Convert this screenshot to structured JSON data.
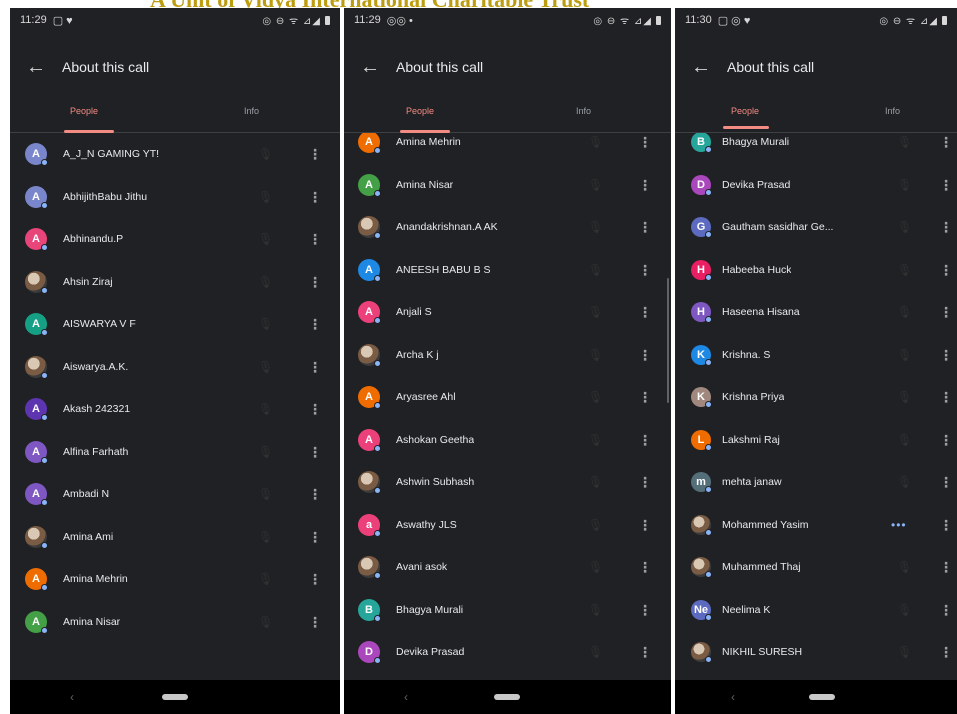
{
  "document_title": "A Unit of Vidya International Charitable Trust",
  "phones": [
    {
      "status_time": "11:29",
      "status_left_icons": "▢ ♥",
      "status_right_icons": "◎ ⊖ ᯤ ⊿◢",
      "app_title": "About this call",
      "tabs": [
        "People",
        "Info"
      ],
      "participants": [
        {
          "name": "A_J_N GAMING YT!",
          "initial": "A",
          "color": "#7986cb"
        },
        {
          "name": "AbhijithBabu Jithu",
          "initial": "A",
          "color": "#7986cb"
        },
        {
          "name": "Abhinandu.P",
          "initial": "A",
          "color": "#e8457a"
        },
        {
          "name": "Ahsin Ziraj",
          "initial": "",
          "color": "#c2185b",
          "photo": true
        },
        {
          "name": "AISWARYA V F",
          "initial": "A",
          "color": "#15a085"
        },
        {
          "name": "Aiswarya.A.K.",
          "initial": "",
          "color": "#f5a623",
          "photo": true
        },
        {
          "name": "Akash 242321",
          "initial": "A",
          "color": "#5e35b1"
        },
        {
          "name": "Alfina Farhath",
          "initial": "A",
          "color": "#7e57c2"
        },
        {
          "name": "Ambadi N",
          "initial": "A",
          "color": "#7e57c2"
        },
        {
          "name": "Amina Ami",
          "initial": "",
          "color": "#444444",
          "photo": true
        },
        {
          "name": "Amina Mehrin",
          "initial": "A",
          "color": "#ef6c00"
        },
        {
          "name": "Amina Nisar",
          "initial": "A",
          "color": "#43a047"
        }
      ]
    },
    {
      "status_time": "11:29",
      "status_left_icons": "◎◎ •",
      "status_right_icons": "◎ ⊖ ᯤ ⊿◢",
      "app_title": "About this call",
      "tabs": [
        "People",
        "Info"
      ],
      "participants": [
        {
          "name": "Amina Mehrin",
          "initial": "A",
          "color": "#ef6c00"
        },
        {
          "name": "Amina Nisar",
          "initial": "A",
          "color": "#43a047"
        },
        {
          "name": "Anandakrishnan.A AK",
          "initial": "",
          "color": "#555555",
          "photo": true
        },
        {
          "name": "ANEESH BABU B S",
          "initial": "A",
          "color": "#1e88e5"
        },
        {
          "name": "Anjali S",
          "initial": "A",
          "color": "#ec407a"
        },
        {
          "name": "Archa K j",
          "initial": "",
          "color": "#777777",
          "photo": true
        },
        {
          "name": "Aryasree Ahl",
          "initial": "A",
          "color": "#ef6c00"
        },
        {
          "name": "Ashokan Geetha",
          "initial": "A",
          "color": "#ec407a"
        },
        {
          "name": "Ashwin Subhash",
          "initial": "",
          "color": "#888888",
          "photo": true
        },
        {
          "name": "Aswathy JLS",
          "initial": "a",
          "color": "#ec407a"
        },
        {
          "name": "Avani asok",
          "initial": "",
          "color": "#4a6fa5",
          "photo": true
        },
        {
          "name": "Bhagya Murali",
          "initial": "B",
          "color": "#26a69a"
        },
        {
          "name": "Devika Prasad",
          "initial": "D",
          "color": "#ab47bc"
        }
      ]
    },
    {
      "status_time": "11:30",
      "status_left_icons": "▢ ◎ ♥",
      "status_right_icons": "◎ ⊖ ᯤ ⊿◢",
      "app_title": "About this call",
      "tabs": [
        "People",
        "Info"
      ],
      "participants": [
        {
          "name": "Bhagya Murali",
          "initial": "B",
          "color": "#26a69a"
        },
        {
          "name": "Devika Prasad",
          "initial": "D",
          "color": "#ab47bc"
        },
        {
          "name": "Gautham sasidhar Ge...",
          "initial": "G",
          "color": "#5c6bc0"
        },
        {
          "name": "Habeeba Huck",
          "initial": "H",
          "color": "#e91e63"
        },
        {
          "name": "Haseena Hisana",
          "initial": "H",
          "color": "#7e57c2"
        },
        {
          "name": "Krishna. S",
          "initial": "K",
          "color": "#1e88e5"
        },
        {
          "name": "Krishna Priya",
          "initial": "K",
          "color": "#a1887f"
        },
        {
          "name": "Lakshmi Raj",
          "initial": "L",
          "color": "#ef6c00"
        },
        {
          "name": "mehta janaw",
          "initial": "m",
          "color": "#546e7a"
        },
        {
          "name": "Mohammed Yasim",
          "initial": "",
          "color": "#8d6e63",
          "photo": true,
          "speaking": true
        },
        {
          "name": "Muhammed Thaj",
          "initial": "",
          "color": "#222222",
          "photo": true
        },
        {
          "name": "Neelima K",
          "initial": "Ne",
          "color": "#5c6bc0"
        },
        {
          "name": "NIKHIL SURESH",
          "initial": "",
          "color": "#9e7b6a",
          "photo": true
        }
      ]
    }
  ]
}
